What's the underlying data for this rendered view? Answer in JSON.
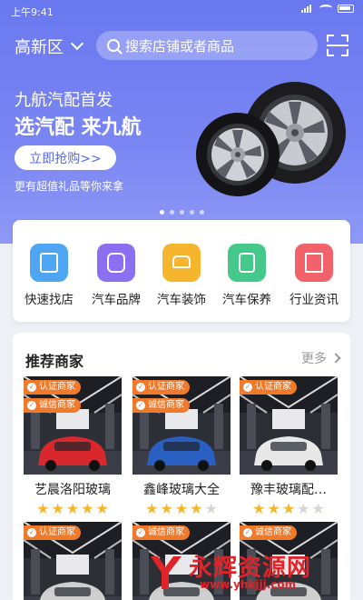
{
  "status": {
    "time": "上午9:41"
  },
  "header": {
    "city": "高新区",
    "search_placeholder": "搜索店铺或者商品"
  },
  "banner": {
    "line1": "九航汽配首发",
    "line2": "选汽配 来九航",
    "button": "立即抢购>>",
    "subtitle": "更有超值礼品等你来拿",
    "page_count": 5,
    "active_page": 0
  },
  "categories": [
    {
      "label": "快速找店",
      "icon": "store-icon",
      "color": "#4ea6f2"
    },
    {
      "label": "汽车品牌",
      "icon": "brand-icon",
      "color": "#8a6ff0"
    },
    {
      "label": "汽车装饰",
      "icon": "car-icon",
      "color": "#f5b52c"
    },
    {
      "label": "汽车保养",
      "icon": "oil-can-icon",
      "color": "#45c98a"
    },
    {
      "label": "行业资讯",
      "icon": "news-icon",
      "color": "#f2626a"
    }
  ],
  "recommend": {
    "title": "推荐商家",
    "more": "更多",
    "shops": [
      {
        "name": "艺晨洛阳玻璃",
        "rating": 5,
        "badges": [
          "认证商家",
          "诚信商家"
        ],
        "car_color": "#d8282e"
      },
      {
        "name": "鑫峰玻璃大全",
        "rating": 4,
        "badges": [
          "认证商家",
          "诚信商家"
        ],
        "car_color": "#2a5fc2"
      },
      {
        "name": "豫丰玻璃配…",
        "rating": 3,
        "badges": [
          "认证商家"
        ],
        "car_color": "#e8e8e8"
      },
      {
        "name": "",
        "rating": 0,
        "badges": [
          "认证商家"
        ],
        "car_color": "#cfcfcf"
      },
      {
        "name": "",
        "rating": 0,
        "badges": [
          "诚信商家"
        ],
        "car_color": "#cfcfcf"
      },
      {
        "name": "",
        "rating": 0,
        "badges": [
          "诚信商家"
        ],
        "car_color": "#cfcfcf"
      }
    ]
  },
  "watermark": {
    "text": "永辉资源网",
    "url": "www.yhkjjj.com"
  },
  "colors": {
    "primary": "#6a78f0",
    "star_on": "#f5b52c",
    "star_off": "#d6d6d6",
    "badge": "#f07a2c"
  }
}
